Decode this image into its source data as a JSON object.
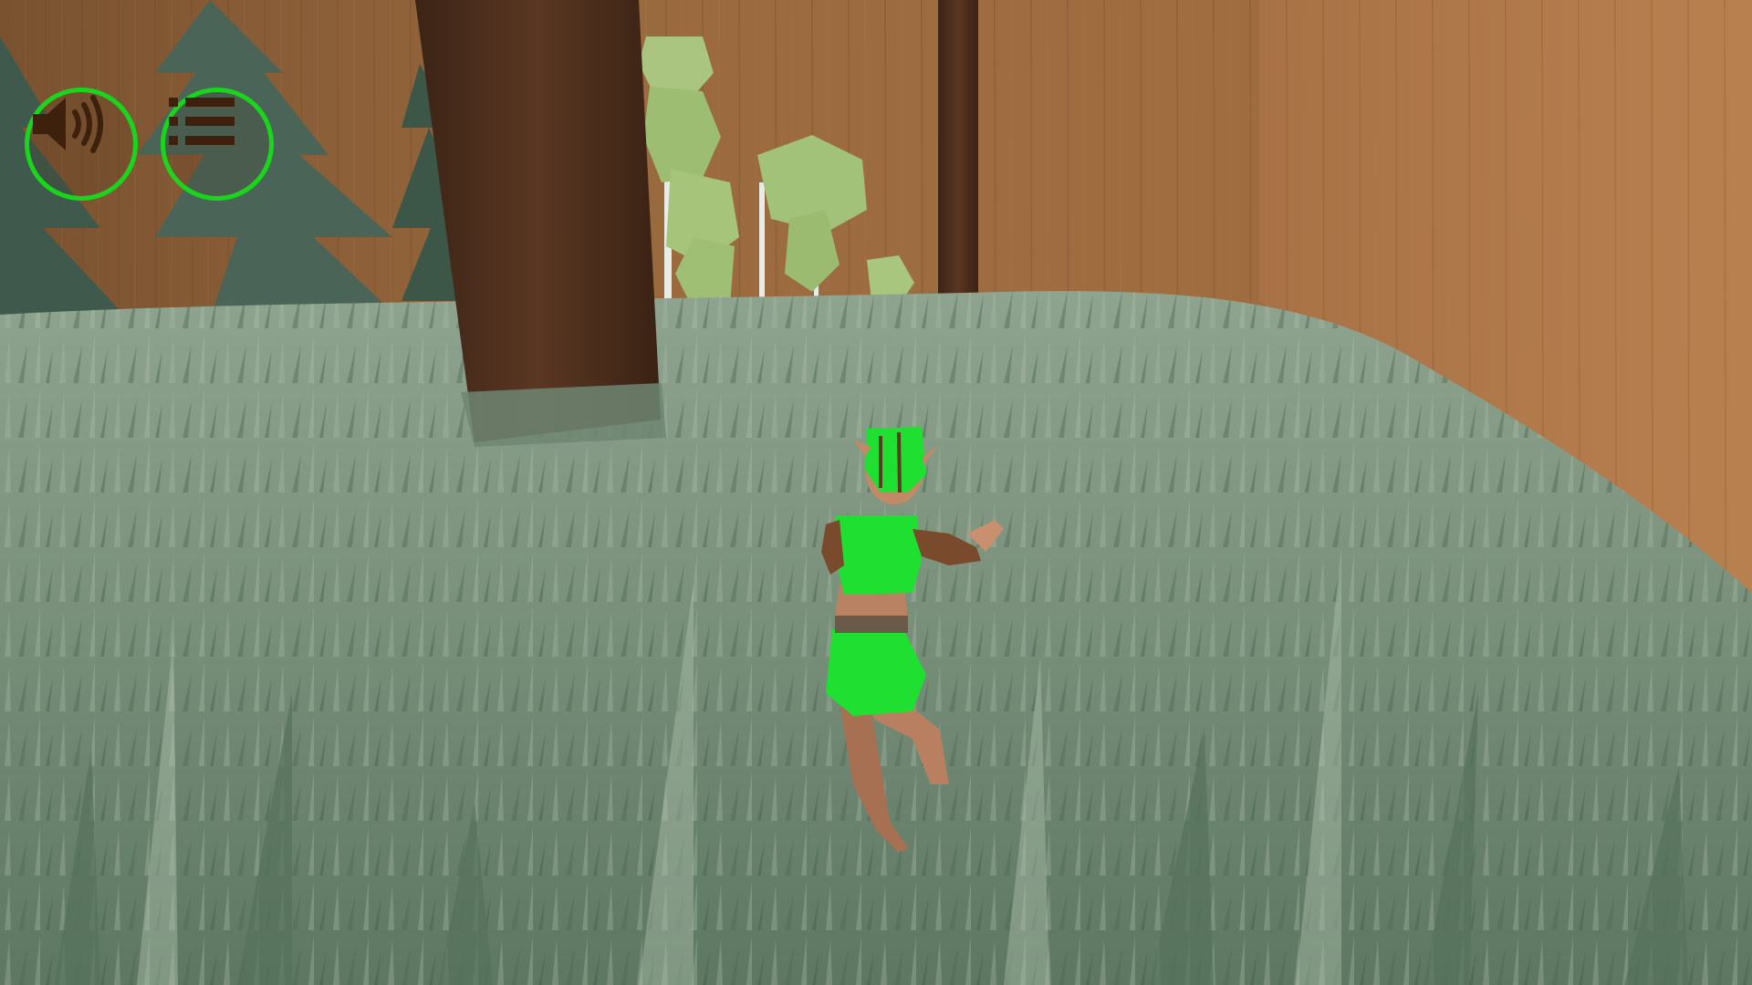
{
  "hud": {
    "buttons": [
      {
        "id": "sound",
        "icon": "speaker-volume-icon",
        "ring_color": "#19d61d",
        "icon_color": "#3d210d"
      },
      {
        "id": "menu",
        "icon": "list-menu-icon",
        "ring_color": "#19d61d",
        "icon_color": "#3d210d"
      }
    ]
  },
  "scene": {
    "player_character": "elf",
    "outfit_color": "#1fe030",
    "ground": "tall-grass",
    "backdrop": "wooden-wall"
  }
}
